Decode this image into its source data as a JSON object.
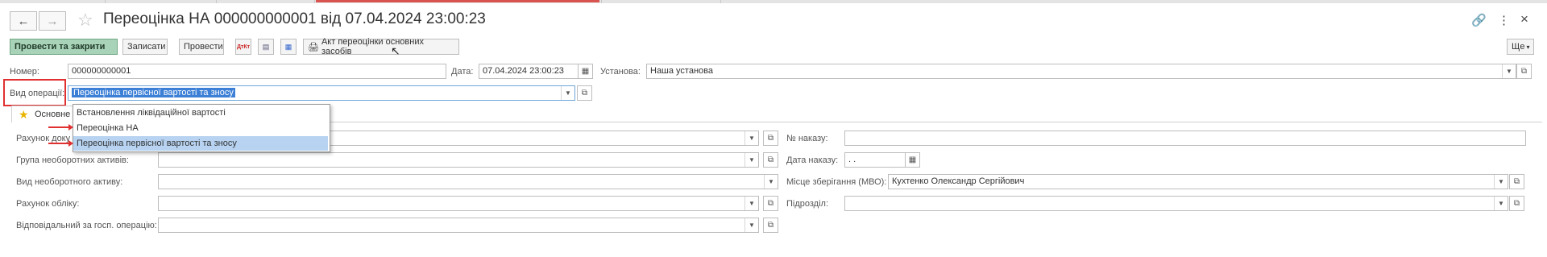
{
  "window": {
    "title": "Переоцінка НА 000000000001 від 07.04.2024 23:00:23",
    "back_icon": "←",
    "forward_icon": "→",
    "star_icon": "☆",
    "link_icon": "🔗",
    "menu_icon": "⋮",
    "close_icon": "×"
  },
  "toolbar": {
    "post_close": "Провести та закрити",
    "save": "Записати",
    "post": "Провести",
    "dtkt_icon": "ДтКт",
    "doc_icon": "▤",
    "report_icon": "▦",
    "print_icon": "🖨",
    "print_act": "Акт переоцінки основних засобів",
    "more": "Ще"
  },
  "header": {
    "number_label": "Номер:",
    "number_value": "000000000001",
    "date_label": "Дата:",
    "date_value": "07.04.2024 23:00:23",
    "org_label": "Установа:",
    "org_value": "Наша установа",
    "op_label": "Вид операції:",
    "op_value": "Переоцінка первісної вартості та зносу"
  },
  "dropdown": {
    "options": [
      "Встановлення ліквідаційної вартості",
      "Переоцінка НА",
      "Переоцінка первісної вартості та зносу"
    ]
  },
  "tab": {
    "main_label": "Основне"
  },
  "form": {
    "doc_account_label": "Рахунок доку",
    "asset_group_label": "Група необоротних активів:",
    "asset_kind_label": "Вид необоротного активу:",
    "account_label": "Рахунок обліку:",
    "responsible_label": "Відповідальний за госп. операцію:",
    "order_no_label": "№ наказу:",
    "order_date_label": "Дата наказу:",
    "order_date_value": " .  .",
    "storage_label": "Місце зберігання (МВО):",
    "storage_value": "Кухтенко Олександр Сергійович",
    "subdivision_label": "Підрозділ:"
  }
}
